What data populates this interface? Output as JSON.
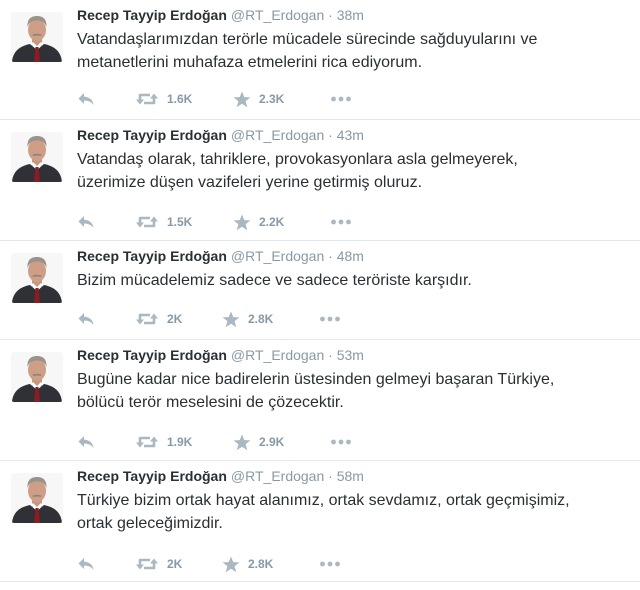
{
  "author": {
    "name": "Recep Tayyip Erdoğan",
    "handle": "@RT_Erdogan",
    "separator": " · "
  },
  "icons": {
    "reply": "reply-arrow-icon",
    "retweet": "retweet-icon",
    "favorite": "star-icon",
    "more": "more-dots-icon"
  },
  "colors": {
    "icon": "#aab8c2",
    "meta": "#8899a6",
    "text": "#292f33",
    "divider": "#e1e8ed"
  },
  "tweets": [
    {
      "time": "38m",
      "lines": [
        "Vatandaşlarımızdan terörle mücadele sürecinde sağduyularını ve",
        "metanetlerini muhafaza etmelerini rica ediyorum."
      ],
      "retweets": "1.6K",
      "favorites": "2.3K"
    },
    {
      "time": "43m",
      "lines": [
        "Vatandaş olarak, tahriklere, provokasyonlara asla gelmeyerek,",
        "üzerimize düşen vazifeleri yerine getirmiş oluruz."
      ],
      "retweets": "1.5K",
      "favorites": "2.2K"
    },
    {
      "time": "48m",
      "lines": [
        "Bizim mücadelemiz sadece ve sadece teröriste karşıdır."
      ],
      "retweets": "2K",
      "favorites": "2.8K"
    },
    {
      "time": "53m",
      "lines": [
        "Bugüne kadar nice badirelerin üstesinden gelmeyi başaran Türkiye,",
        "bölücü terör meselesini de çözecektir."
      ],
      "retweets": "1.9K",
      "favorites": "2.9K"
    },
    {
      "time": "58m",
      "lines": [
        "Türkiye bizim ortak hayat alanımız, ortak sevdamız, ortak geçmişimiz,",
        "ortak geleceğimizdir."
      ],
      "retweets": "2K",
      "favorites": "2.8K"
    }
  ]
}
